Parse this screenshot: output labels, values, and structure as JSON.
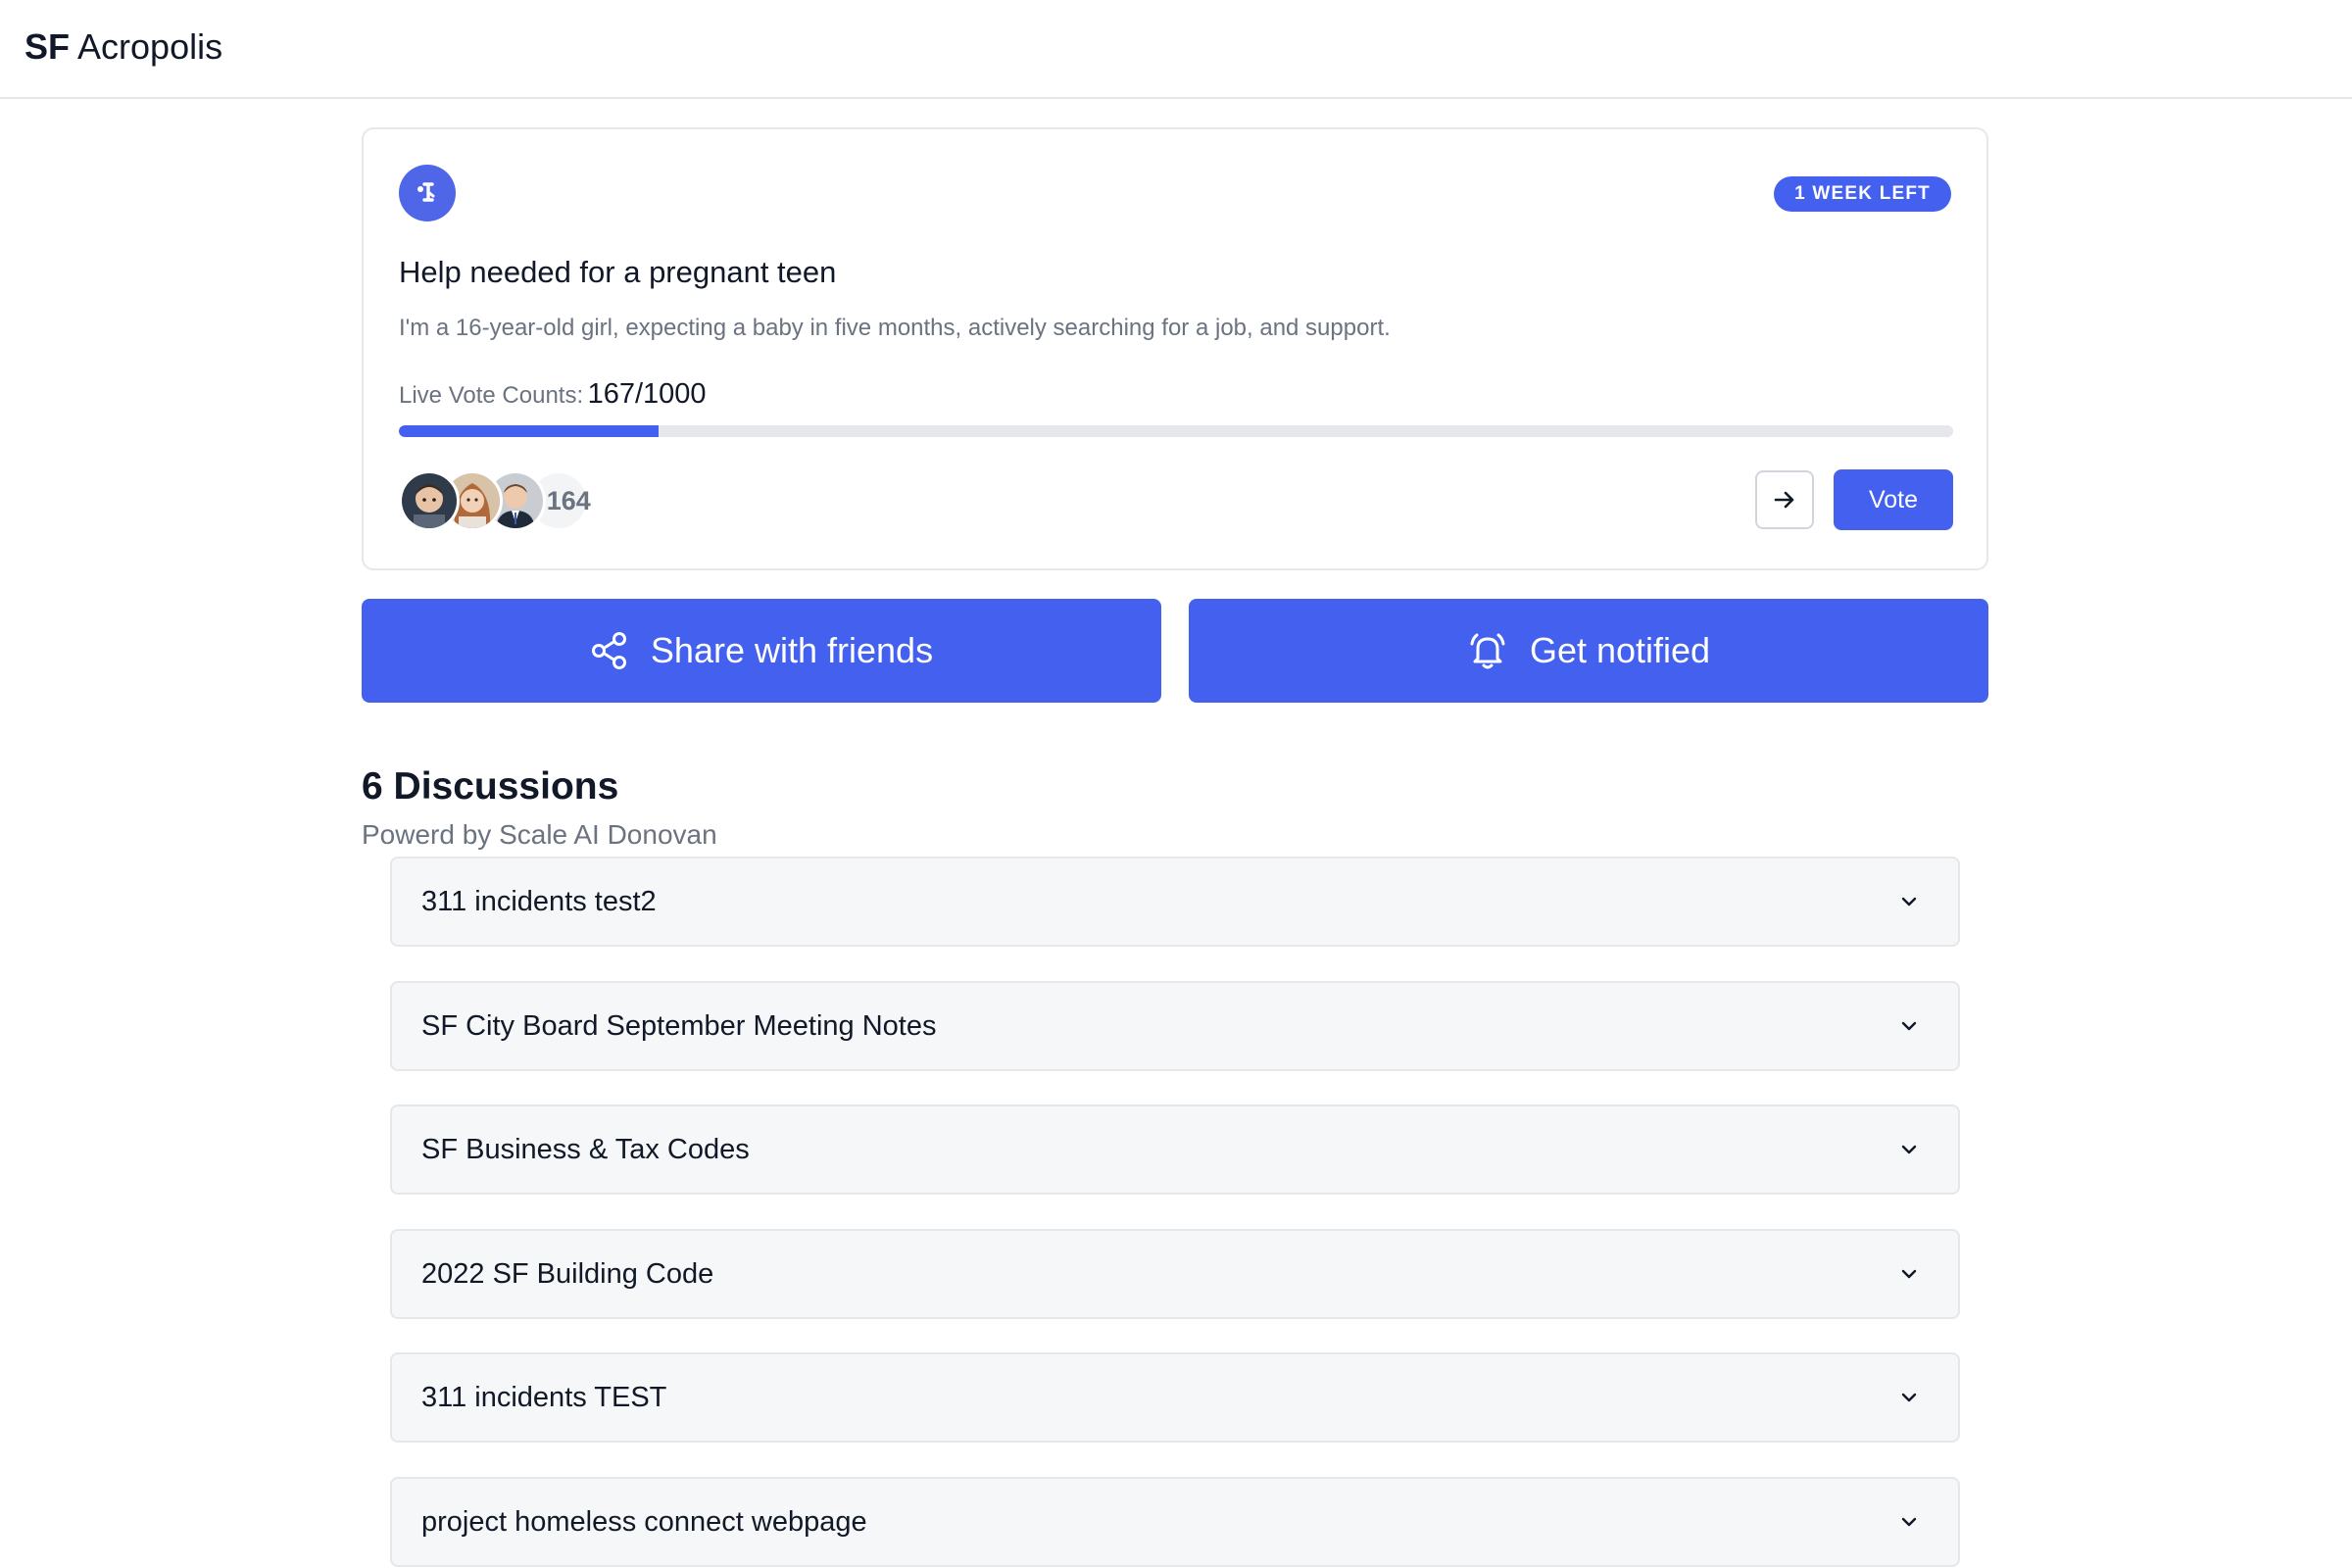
{
  "header": {
    "brand_bold": "SF",
    "brand_rest": "Acropolis"
  },
  "petition": {
    "badge": "1 WEEK LEFT",
    "title": "Help needed for a pregnant teen",
    "description": "I'm a 16-year-old girl, expecting a baby in five months, actively searching for a job, and support.",
    "vote_label": "Live Vote Counts:",
    "vote_count": "167/1000",
    "progress_fraction": 0.167,
    "more_voters": "+164",
    "vote_button": "Vote",
    "icons": {
      "logo": "person-icon",
      "next": "arrow-right-icon"
    }
  },
  "actions": {
    "share_label": "Share with friends",
    "notify_label": "Get notified",
    "share_icon": "share-icon",
    "notify_icon": "bell-icon"
  },
  "discussions": {
    "heading": "6 Discussions",
    "subheading": "Powerd by Scale AI Donovan",
    "items": [
      {
        "label": "311 incidents test2"
      },
      {
        "label": "SF City Board September Meeting Notes"
      },
      {
        "label": "SF Business & Tax Codes"
      },
      {
        "label": "2022 SF Building Code"
      },
      {
        "label": "311 incidents TEST"
      },
      {
        "label": "project homeless connect webpage"
      }
    ]
  },
  "colors": {
    "accent": "#4361ee",
    "muted_text": "#6b7280",
    "border": "#e5e7eb",
    "item_bg": "#f6f7f9"
  }
}
